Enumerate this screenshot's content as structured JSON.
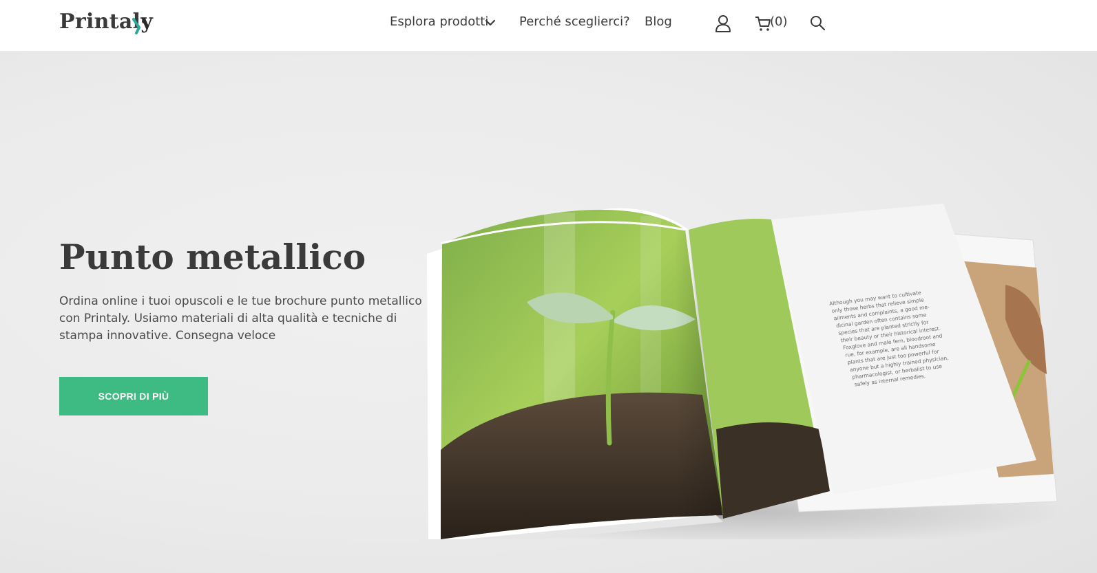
{
  "header": {
    "logo_text": "Printal",
    "logo_tail": "y",
    "nav": {
      "explore_label": "Esplora prodotti",
      "why_label": "Perché sceglierci?",
      "blog_label": "Blog"
    },
    "cart_count": "(0)"
  },
  "hero": {
    "title": "Punto metallico",
    "description": "Ordina online i tuoi opuscoli e le tue brochure punto metallico con Printaly. Usiamo materiali di alta qualità e tecniche di stampa innovative. Consegna veloce",
    "cta_label": "SCOPRI DI PIÙ",
    "brochure_text": [
      "Although you may want to cultivate",
      "only those herbs that relieve simple",
      "ailments and complaints, a good me-",
      "dicinal garden often contains some",
      "species that are planted strictly for",
      "their beauty or their historical interest.",
      "Foxglove and male fern, bloodroot and",
      "rue, for example, are all handsome",
      "plants that are just too powerful for",
      "anyone but a highly trained physician,",
      "pharmacologist, or herbalist to use",
      "safely as internal remedies."
    ]
  },
  "colors": {
    "accent": "#3dbb82",
    "logo_teal": "#2aa89a",
    "text_dark": "#3a3a3a"
  },
  "icons": [
    "chevron-down-icon",
    "user-icon",
    "cart-icon",
    "search-icon"
  ]
}
